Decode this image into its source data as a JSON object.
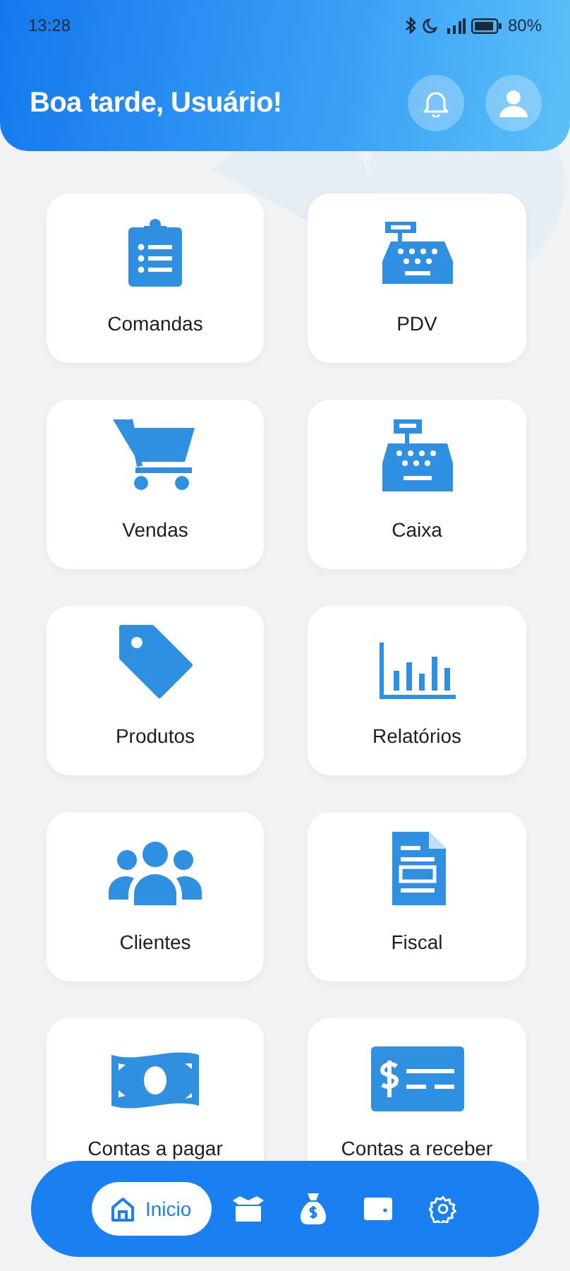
{
  "status_bar": {
    "time": "13:28",
    "battery": "80%"
  },
  "header": {
    "greeting": "Boa tarde, Usuário!"
  },
  "tiles": [
    {
      "label": "Comandas"
    },
    {
      "label": "PDV"
    },
    {
      "label": "Vendas"
    },
    {
      "label": "Caixa"
    },
    {
      "label": "Produtos"
    },
    {
      "label": "Relatórios"
    },
    {
      "label": "Clientes"
    },
    {
      "label": "Fiscal"
    },
    {
      "label": "Contas a pagar"
    },
    {
      "label": "Contas a receber"
    }
  ],
  "bottom_nav": [
    {
      "label": "Inicio",
      "selected": true
    },
    {
      "selected": false
    },
    {
      "selected": false
    },
    {
      "selected": false
    },
    {
      "selected": false
    }
  ]
}
